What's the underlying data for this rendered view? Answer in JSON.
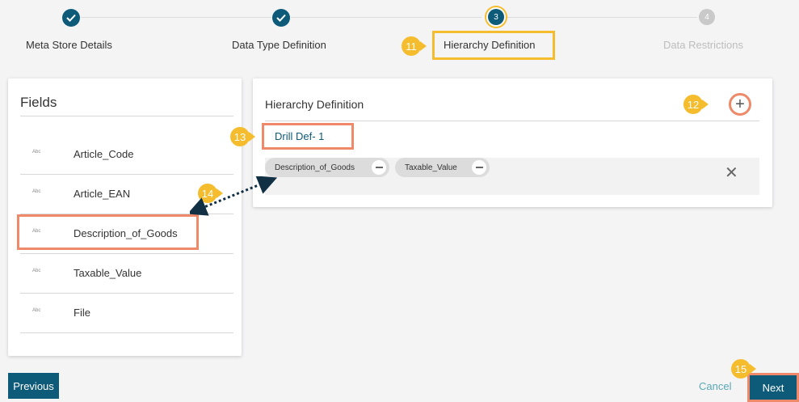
{
  "stepper": {
    "steps": [
      {
        "label": "Meta Store Details",
        "state": "done",
        "number": ""
      },
      {
        "label": "Data Type Definition",
        "state": "done",
        "number": ""
      },
      {
        "label": "Hierarchy Definition",
        "state": "current",
        "number": "3"
      },
      {
        "label": "Data Restrictions",
        "state": "todo",
        "number": "4"
      }
    ]
  },
  "fields": {
    "title": "Fields",
    "type_badge": "Abc",
    "items": [
      {
        "name": "Article_Code"
      },
      {
        "name": "Article_EAN"
      },
      {
        "name": "Description_of_Goods"
      },
      {
        "name": "Taxable_Value"
      },
      {
        "name": "File"
      }
    ]
  },
  "hierarchy": {
    "title": "Hierarchy Definition",
    "add_icon": "plus-icon",
    "drill": {
      "label": "Drill Def- 1",
      "chips": [
        {
          "label": "Description_of_Goods"
        },
        {
          "label": "Taxable_Value"
        }
      ],
      "close_icon": "close-icon"
    }
  },
  "callouts": {
    "c11": "11",
    "c12": "12",
    "c13": "13",
    "c14": "14",
    "c15": "15"
  },
  "footer": {
    "previous_label": "Previous",
    "cancel_label": "Cancel",
    "next_label": "Next"
  },
  "colors": {
    "primary": "#0d5a79",
    "callout": "#f5bd2d",
    "highlight_orange": "#ee8a6a",
    "cancel_link": "#5aa7b4"
  }
}
